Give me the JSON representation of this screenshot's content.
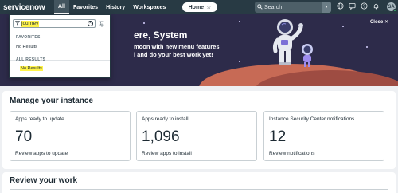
{
  "nav": {
    "logo": "servicenow",
    "tabs": [
      {
        "label": "All",
        "active": true
      },
      {
        "label": "Favorites",
        "active": false
      },
      {
        "label": "History",
        "active": false
      },
      {
        "label": "Workspaces",
        "active": false
      }
    ],
    "home_label": "Home",
    "search_placeholder": "Search",
    "avatar_initials": "SA",
    "icons": [
      "globe-icon",
      "sidebar-chat-icon",
      "help-icon",
      "notifications-icon"
    ]
  },
  "filter_menu": {
    "filter_value": "journey",
    "sections": [
      {
        "heading": "FAVORITES",
        "message": "No Results",
        "highlighted": false
      },
      {
        "heading": "ALL RESULTS",
        "message": "No Results",
        "highlighted": true
      }
    ]
  },
  "banner": {
    "title_partial": "ere, System",
    "line1_partial": "moon with new menu features",
    "line2_partial": "l and do your best work yet!",
    "close_label": "Close"
  },
  "manage": {
    "title": "Manage your instance",
    "cards": [
      {
        "title": "Apps ready to update",
        "value": "70",
        "link": "Review apps to update"
      },
      {
        "title": "Apps ready to install",
        "value": "1,096",
        "link": "Review apps to install"
      },
      {
        "title": "Instance Security Center notifications",
        "value": "12",
        "link": "Review notifications"
      }
    ]
  },
  "review": {
    "title": "Review your work"
  },
  "colors": {
    "topbar": "#283a44",
    "banner": "#2d2b4a",
    "highlight": "#fff34a",
    "brand_dot": "#7fd34a"
  }
}
